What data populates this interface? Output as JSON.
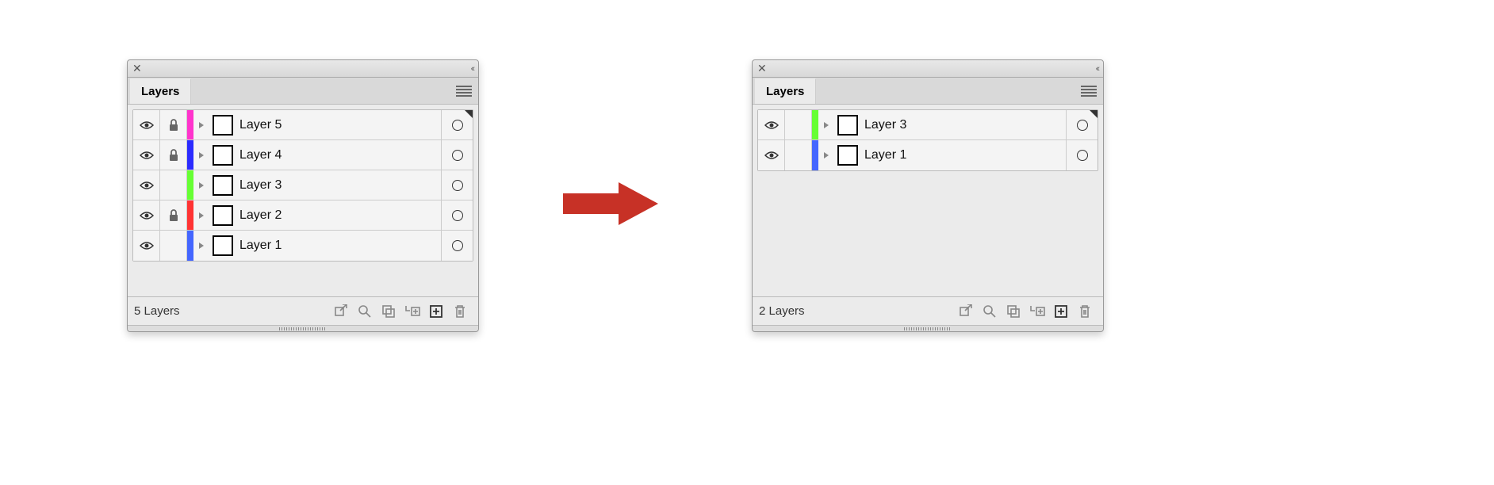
{
  "panels": [
    {
      "tab_label": "Layers",
      "footer_count": "5 Layers",
      "rows": [
        {
          "name": "Layer 5",
          "color": "#ff33cc",
          "locked": true
        },
        {
          "name": "Layer 4",
          "color": "#2b2bff",
          "locked": true
        },
        {
          "name": "Layer 3",
          "color": "#66ff33",
          "locked": false
        },
        {
          "name": "Layer 2",
          "color": "#ff3333",
          "locked": true
        },
        {
          "name": "Layer 1",
          "color": "#4466ff",
          "locked": false
        }
      ]
    },
    {
      "tab_label": "Layers",
      "footer_count": "2 Layers",
      "rows": [
        {
          "name": "Layer 3",
          "color": "#66ff33",
          "locked": false
        },
        {
          "name": "Layer 1",
          "color": "#4466ff",
          "locked": false
        }
      ]
    }
  ]
}
